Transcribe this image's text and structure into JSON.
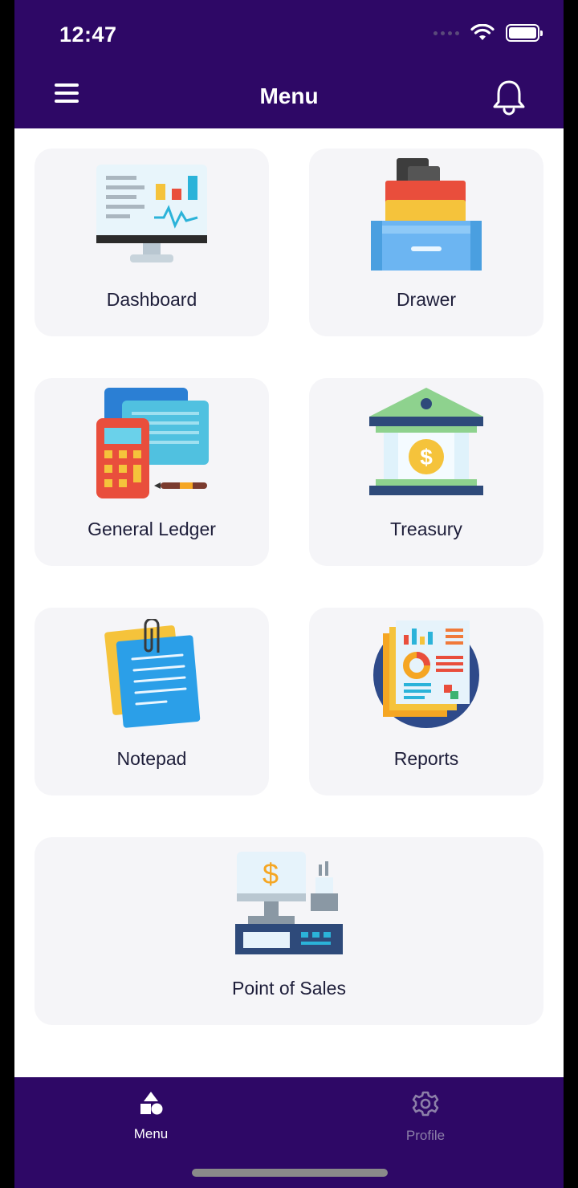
{
  "status_bar": {
    "time": "12:47"
  },
  "header": {
    "title": "Menu"
  },
  "cards": [
    {
      "label": "Dashboard",
      "icon": "dashboard-monitor-icon"
    },
    {
      "label": "Drawer",
      "icon": "drawer-icon"
    },
    {
      "label": "General Ledger",
      "icon": "general-ledger-icon"
    },
    {
      "label": "Treasury",
      "icon": "treasury-bank-icon"
    },
    {
      "label": "Notepad",
      "icon": "notepad-icon"
    },
    {
      "label": "Reports",
      "icon": "reports-icon"
    },
    {
      "label": "Point of Sales",
      "icon": "point-of-sales-icon"
    }
  ],
  "bottom_nav": [
    {
      "label": "Menu",
      "icon": "shapes-icon",
      "active": true
    },
    {
      "label": "Profile",
      "icon": "gear-icon",
      "active": false
    }
  ],
  "colors": {
    "brand": "#2e0866",
    "card_bg": "#f5f5f8",
    "inactive_nav": "#8c7fa8"
  }
}
